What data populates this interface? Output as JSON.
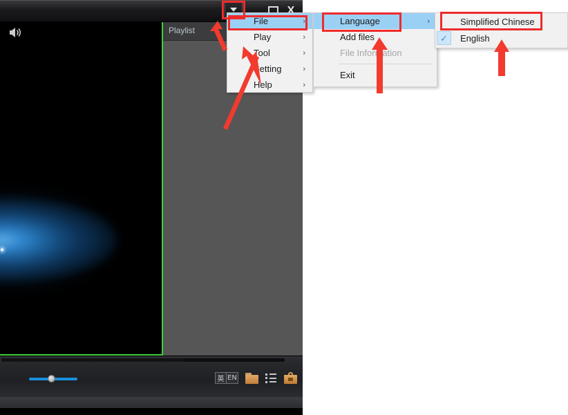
{
  "window": {
    "title": "",
    "controls": {
      "minimize": "—",
      "maximize": "□",
      "close": "X"
    },
    "menu_toggle_label": "menu-toggle"
  },
  "playlist": {
    "header": "Playlist",
    "items": []
  },
  "controls_bar": {
    "volume_icon": "speaker-icon",
    "volume_value": 50,
    "seek_value": 65,
    "right_icons": [
      {
        "name": "ime-chinese",
        "label": "英"
      },
      {
        "name": "ime-english",
        "label": "EN"
      },
      {
        "name": "open-folder",
        "label": ""
      },
      {
        "name": "playlist-toggle",
        "label": ""
      },
      {
        "name": "toolbox",
        "label": ""
      }
    ]
  },
  "menu_main": {
    "items": [
      {
        "label": "File",
        "submenu": true,
        "selected": true,
        "disabled": false
      },
      {
        "label": "Play",
        "submenu": true,
        "selected": false,
        "disabled": false
      },
      {
        "label": "Tool",
        "submenu": true,
        "selected": false,
        "disabled": false
      },
      {
        "label": "Setting",
        "submenu": true,
        "selected": false,
        "disabled": false
      },
      {
        "label": "Help",
        "submenu": true,
        "selected": false,
        "disabled": false
      }
    ]
  },
  "menu_file": {
    "items": [
      {
        "label": "Language",
        "submenu": true,
        "selected": true,
        "disabled": false
      },
      {
        "label": "Add files",
        "submenu": false,
        "selected": false,
        "disabled": false
      },
      {
        "label": "File Information",
        "submenu": false,
        "selected": false,
        "disabled": true
      },
      {
        "label": "Exit",
        "submenu": false,
        "selected": false,
        "disabled": false
      }
    ]
  },
  "menu_language": {
    "items": [
      {
        "label": "Simplified Chinese",
        "checked": false
      },
      {
        "label": "English",
        "checked": true
      }
    ]
  },
  "annotations": {
    "highlight_color": "#ef2b2b",
    "boxes": [
      "menu-toggle",
      "File",
      "Language",
      "Simplified Chinese"
    ],
    "arrows": 4
  },
  "colors": {
    "menu_highlight": "#9bd0f5",
    "annotation_red": "#ef2b2b",
    "video_border_green": "#3cd23c",
    "volume_blue": "#1a8fe0"
  }
}
